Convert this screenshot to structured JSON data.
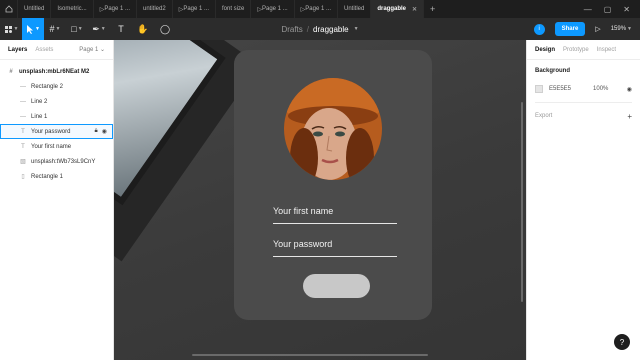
{
  "tabs": [
    {
      "label": "Untitled"
    },
    {
      "label": "Isometric..."
    },
    {
      "label": "Page 1 ..."
    },
    {
      "label": "untitled2"
    },
    {
      "label": "Page 1 ..."
    },
    {
      "label": "font size"
    },
    {
      "label": "Page 1 ..."
    },
    {
      "label": "Page 1 ..."
    },
    {
      "label": "Untitled"
    },
    {
      "label": "draggable",
      "active": true
    }
  ],
  "tab_add_label": "+",
  "breadcrumb": {
    "drafts": "Drafts",
    "sep": "/",
    "file": "draggable"
  },
  "toolbar": {
    "avatar_letter": "i",
    "share_label": "Share",
    "zoom_label": "159%"
  },
  "left_panel": {
    "tab_layers": "Layers",
    "tab_assets": "Assets",
    "page_label": "Page 1 ⌄",
    "root_layer": "unsplash:mbLr6NEat M2",
    "layers": [
      {
        "icon": "rectangle-icon",
        "label": "Rectangle 2"
      },
      {
        "icon": "line-icon",
        "label": "Line 2"
      },
      {
        "icon": "line-icon",
        "label": "Line 1"
      },
      {
        "icon": "text-icon",
        "label": "Your password",
        "selected": true
      },
      {
        "icon": "text-icon",
        "label": "Your first name"
      },
      {
        "icon": "image-icon",
        "label": "unsplash:tWb73sL9CnY"
      },
      {
        "icon": "rectangle-icon",
        "label": "Rectangle 1"
      }
    ]
  },
  "card": {
    "first_name_label": "Your first name",
    "password_label": "Your password"
  },
  "right_panel": {
    "tab_design": "Design",
    "tab_prototype": "Prototype",
    "tab_inspect": "Inspect",
    "background_title": "Background",
    "bg_hex": "E5E5E5",
    "bg_opacity": "100%",
    "export_label": "Export"
  },
  "colors": {
    "accent": "#0d99ff",
    "card": "#4b4b4b",
    "canvas_bg": "E5E5E5"
  },
  "help_label": "?"
}
